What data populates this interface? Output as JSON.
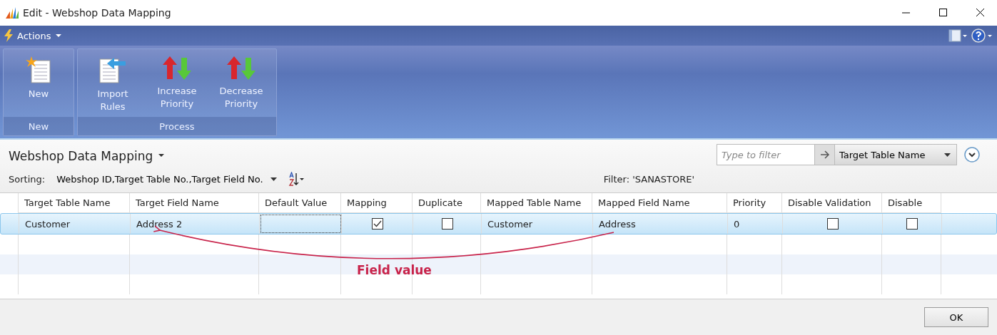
{
  "window": {
    "title": "Edit - Webshop Data Mapping"
  },
  "action_bar": {
    "menu": "Actions"
  },
  "ribbon": {
    "groups": [
      {
        "label": "New",
        "buttons": [
          {
            "label": "New",
            "kind": "new"
          }
        ]
      },
      {
        "label": "Process",
        "buttons": [
          {
            "label": "Import Rules",
            "kind": "import"
          },
          {
            "label": "Increase Priority",
            "kind": "priority"
          },
          {
            "label": "Decrease Priority",
            "kind": "priority"
          }
        ]
      }
    ]
  },
  "list": {
    "title": "Webshop Data Mapping",
    "sorting_label": "Sorting:",
    "sorting": "Webshop ID,Target Table No.,Target Field No.",
    "filter_placeholder": "Type to filter",
    "filter_field": "Target Table Name",
    "filter": "Filter: 'SANASTORE'"
  },
  "table": {
    "columns": [
      {
        "label": "Target Table Name",
        "kind": "text"
      },
      {
        "label": "Target Field Name",
        "kind": "text"
      },
      {
        "label": "Default Value",
        "kind": "text"
      },
      {
        "label": "Mapping",
        "kind": "check"
      },
      {
        "label": "Duplicate",
        "kind": "check"
      },
      {
        "label": "Mapped Table Name",
        "kind": "text"
      },
      {
        "label": "Mapped Field Name",
        "kind": "text"
      },
      {
        "label": "Priority",
        "kind": "text"
      },
      {
        "label": "Disable Validation",
        "kind": "check"
      },
      {
        "label": "Disable",
        "kind": "check"
      }
    ],
    "rows": [
      {
        "selected": true,
        "cells": [
          {
            "text": "Customer",
            "focused": false
          },
          {
            "text": "Address 2",
            "focused": false
          },
          {
            "focused": true
          },
          {
            "checked": true,
            "focused": false
          },
          {
            "checked": false,
            "focused": false
          },
          {
            "text": "Customer",
            "focused": false
          },
          {
            "text": "Address",
            "focused": false
          },
          {
            "text": "0",
            "focused": false
          },
          {
            "checked": false,
            "focused": false
          },
          {
            "checked": false,
            "focused": false
          }
        ]
      }
    ]
  },
  "annotation": {
    "label": "Field value"
  },
  "footer": {
    "buttons": [
      "OK"
    ]
  }
}
